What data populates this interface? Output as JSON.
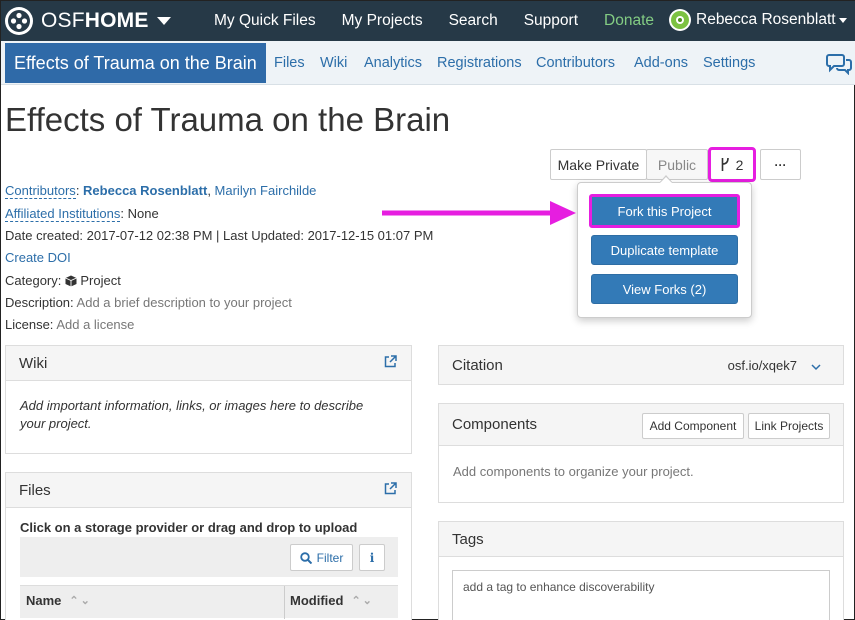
{
  "topnav": {
    "brand_light": "OSF",
    "brand_bold": "HOME",
    "links": [
      "My Quick Files",
      "My Projects",
      "Search",
      "Support",
      "Donate"
    ],
    "user_name": "Rebecca Rosenblatt",
    "colors": {
      "bar": "#263947",
      "donate": "#83cc83"
    }
  },
  "projnav": {
    "title": "Effects of Trauma on the Brain",
    "tabs": [
      "Files",
      "Wiki",
      "Analytics",
      "Registrations",
      "Contributors",
      "Add-ons",
      "Settings"
    ],
    "chat_icon": "comments-icon"
  },
  "header": {
    "title": "Effects of Trauma on the Brain",
    "make_private_label": "Make Private",
    "public_label": "Public",
    "fork_count": "2",
    "more_label": "···"
  },
  "info": {
    "contributors_label": "Contributors",
    "contributor_1": "Rebecca Rosenblatt",
    "contributor_2": "Marilyn Fairchilde",
    "affiliated_label": "Affiliated Institutions",
    "affiliated_value": "None",
    "dates": "Date created: 2017-07-12 02:38 PM | Last Updated: 2017-12-15 01:07 PM",
    "create_doi": "Create DOI",
    "category_label": "Category:",
    "category_value": "Project",
    "description_label": "Description:",
    "description_placeholder": "Add a brief description to your project",
    "license_label": "License:",
    "license_placeholder": "Add a license"
  },
  "fork_menu": {
    "items": [
      "Fork this Project",
      "Duplicate template",
      "View Forks (2)"
    ],
    "highlight_color": "#e61ee0"
  },
  "wiki": {
    "title": "Wiki",
    "body": "Add important information, links, or images here to describe your project."
  },
  "files": {
    "title": "Files",
    "instruction": "Click on a storage provider or drag and drop to upload",
    "filter_label": "Filter",
    "info_label": "i",
    "col_name": "Name",
    "col_modified": "Modified"
  },
  "citation": {
    "title": "Citation",
    "url": "osf.io/xqek7"
  },
  "components": {
    "title": "Components",
    "add_label": "Add Component",
    "link_label": "Link Projects",
    "empty": "Add components to organize your project."
  },
  "tags": {
    "title": "Tags",
    "placeholder": "add a tag to enhance discoverability"
  }
}
